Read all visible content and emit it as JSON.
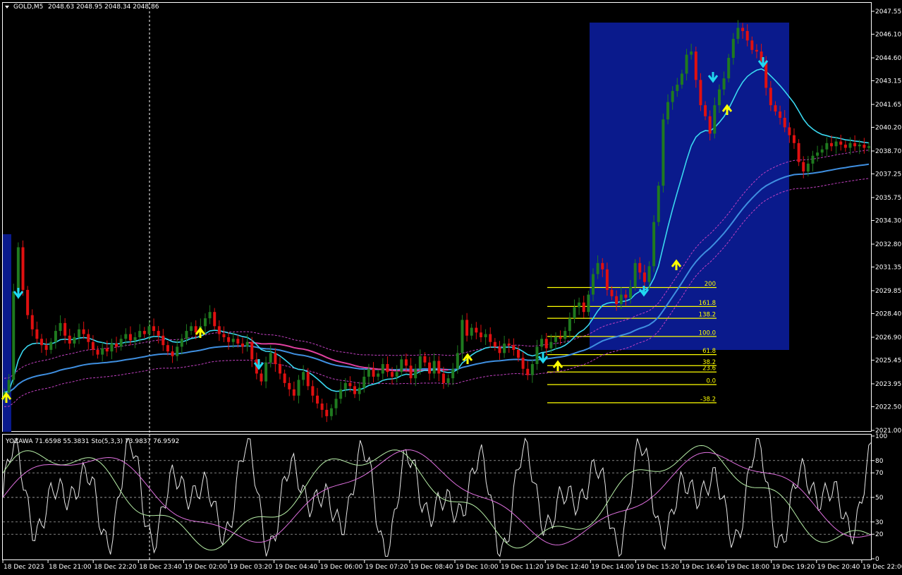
{
  "header": {
    "symbol": "GOLD,M5",
    "ohlc": "2048.63 2048.95 2048.34 2048.86"
  },
  "indicator_header": "YOZAWA 71.6598 55.3831  Sto(5,3,3) 73.9837 76.9592",
  "price_axis": [
    "2047.55",
    "2046.10",
    "2044.60",
    "2043.15",
    "2041.65",
    "2040.20",
    "2038.70",
    "2037.25",
    "2035.75",
    "2034.30",
    "2032.80",
    "2031.35",
    "2029.85",
    "2028.40",
    "2026.90",
    "2025.45",
    "2023.95",
    "2022.50",
    "2021.00"
  ],
  "osc_axis": [
    "100",
    "80",
    "70",
    "50",
    "30",
    "20",
    "0"
  ],
  "time_axis": [
    "18 Dec 2023",
    "18 Dec 21:00",
    "18 Dec 22:20",
    "18 Dec 23:40",
    "19 Dec 02:00",
    "19 Dec 03:20",
    "19 Dec 04:40",
    "19 Dec 06:00",
    "19 Dec 07:20",
    "19 Dec 08:40",
    "19 Dec 10:00",
    "19 Dec 11:20",
    "19 Dec 12:40",
    "19 Dec 14:00",
    "19 Dec 15:20",
    "19 Dec 16:40",
    "19 Dec 18:00",
    "19 Dec 19:20",
    "19 Dec 20:40",
    "19 Dec 22:00"
  ],
  "fibonacci": [
    {
      "level": "200",
      "price": 2030.05
    },
    {
      "level": "161.8",
      "price": 2028.85
    },
    {
      "level": "138.2",
      "price": 2028.1
    },
    {
      "level": "100.0",
      "price": 2026.95
    },
    {
      "level": "61.8",
      "price": 2025.8
    },
    {
      "level": "38.2",
      "price": 2025.1
    },
    {
      "level": "23.6",
      "price": 2024.7
    },
    {
      "level": "0.0",
      "price": 2023.9
    },
    {
      "level": "-38.2",
      "price": 2022.75
    }
  ],
  "colors": {
    "background": "#000000",
    "bull": "#1f7a1f",
    "bear": "#e01010",
    "ma_fast": "#3ad8f0",
    "ma_slow": "#3f8fe0",
    "ma_pink": "#e040a0",
    "envelope": "#c040c0",
    "fib": "#ffff00",
    "box": "#0a1a8c",
    "arrow_up": "#ffff00",
    "arrow_down": "#20d8f0",
    "grid": "#ffffff"
  },
  "chart_data": {
    "type": "candlestick",
    "symbol": "GOLD,M5",
    "ylim": [
      2021.0,
      2047.55
    ],
    "closes": [
      2023.4,
      2024.2,
      2029.8,
      2032.6,
      2029.9,
      2028.3,
      2027.4,
      2026.8,
      2026.4,
      2026.1,
      2026.6,
      2027.3,
      2027.8,
      2027.0,
      2026.5,
      2026.9,
      2027.4,
      2027.1,
      2026.6,
      2026.1,
      2025.8,
      2026.2,
      2026.0,
      2026.5,
      2026.3,
      2026.8,
      2027.1,
      2026.7,
      2026.9,
      2027.3,
      2027.1,
      2027.6,
      2027.3,
      2027.0,
      2026.4,
      2026.0,
      2025.7,
      2026.3,
      2026.8,
      2027.3,
      2027.6,
      2027.2,
      2027.6,
      2028.1,
      2028.5,
      2027.6,
      2027.1,
      2026.9,
      2026.6,
      2026.8,
      2026.5,
      2026.3,
      2026.6,
      2025.5,
      2024.6,
      2024.1,
      2025.3,
      2025.9,
      2025.2,
      2024.6,
      2024.0,
      2023.6,
      2023.2,
      2024.2,
      2024.7,
      2023.8,
      2023.2,
      2022.7,
      2022.3,
      2021.9,
      2022.4,
      2023.0,
      2023.6,
      2024.0,
      2023.8,
      2023.3,
      2023.7,
      2024.4,
      2024.9,
      2024.4,
      2024.6,
      2025.2,
      2024.7,
      2024.4,
      2024.7,
      2025.5,
      2025.1,
      2024.3,
      2024.9,
      2025.7,
      2025.3,
      2024.6,
      2025.4,
      2024.6,
      2024.0,
      2024.3,
      2024.9,
      2025.9,
      2028.0,
      2027.0,
      2027.5,
      2027.2,
      2026.9,
      2027.1,
      2026.6,
      2026.3,
      2025.9,
      2026.5,
      2026.4,
      2026.1,
      2025.6,
      2024.9,
      2024.5,
      2025.2,
      2026.3,
      2026.8,
      2026.2,
      2026.6,
      2026.9,
      2026.8,
      2027.3,
      2028.1,
      2028.8,
      2029.1,
      2028.5,
      2029.6,
      2030.9,
      2031.6,
      2031.2,
      2029.9,
      2029.5,
      2029.0,
      2029.6,
      2029.4,
      2030.1,
      2031.6,
      2031.0,
      2030.4,
      2031.4,
      2034.2,
      2036.5,
      2040.7,
      2041.8,
      2042.5,
      2042.9,
      2043.6,
      2044.8,
      2045.0,
      2043.2,
      2041.6,
      2040.9,
      2039.8,
      2041.6,
      2042.6,
      2043.3,
      2044.6,
      2045.8,
      2046.5,
      2046.3,
      2045.7,
      2045.1,
      2045.0,
      2044.4,
      2042.7,
      2041.6,
      2041.2,
      2040.8,
      2040.2,
      2039.7,
      2039.2,
      2038.0,
      2037.4,
      2037.9,
      2038.4,
      2038.6,
      2038.8,
      2039.2,
      2039.0,
      2039.3,
      2039.1,
      2038.9,
      2039.2,
      2039.0,
      2039.1,
      2038.9,
      2039.0
    ]
  }
}
